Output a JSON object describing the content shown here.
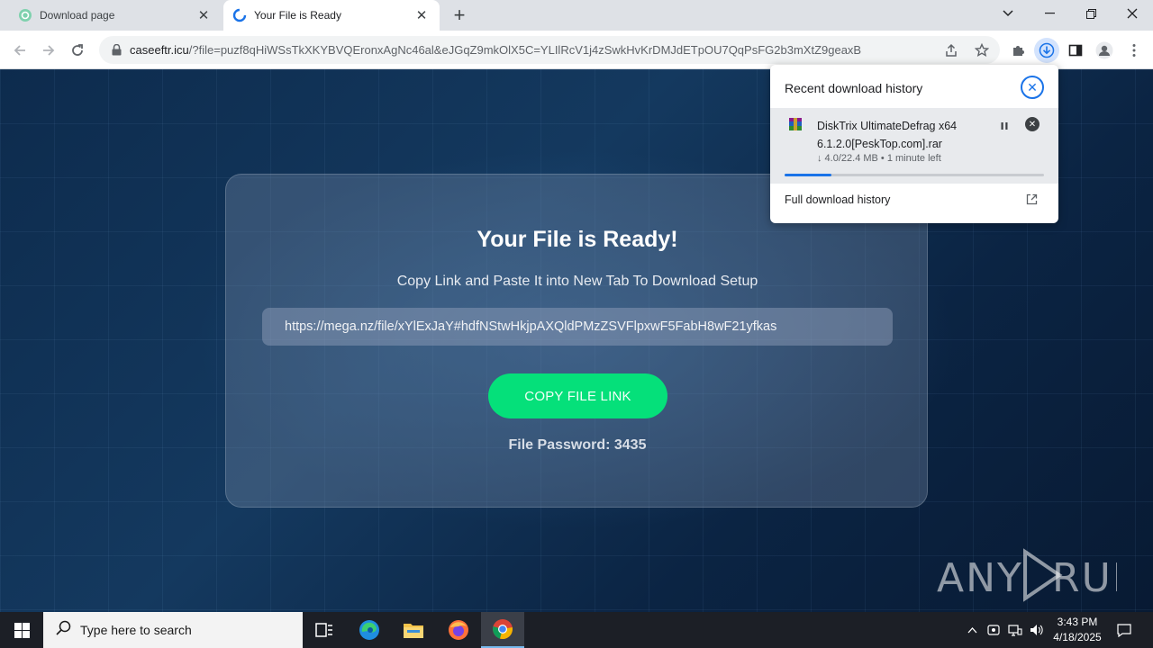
{
  "browser": {
    "tabs": [
      {
        "title": "Download page",
        "active": false
      },
      {
        "title": "Your File is Ready",
        "active": true
      }
    ],
    "url_host": "caseeftr.icu",
    "url_rest": "/?file=puzf8qHiWSsTkXKYBVQEronxAgNc46al&eJGqZ9mkOlX5C=YLIlRcV1j4zSwkHvKrDMJdETpOU7QqPsFG2b3mXtZ9geaxB"
  },
  "page": {
    "title": "Your File is Ready!",
    "subtitle": "Copy Link and Paste It into New Tab To Download Setup",
    "link": "https://mega.nz/file/xYlExJaY#hdfNStwHkjpAXQldPMzZSVFlpxwF5FabH8wF21yfkas",
    "copy_button": "COPY FILE LINK",
    "password": "File Password: 3435",
    "watermark": "ANY RUN"
  },
  "downloads": {
    "header": "Recent download history",
    "item": {
      "name": "DiskTrix UltimateDefrag x64 6.1.2.0[PeskTop.com].rar",
      "status": "↓ 4.0/22.4 MB • 1 minute left",
      "progress": 0.18
    },
    "full_history": "Full download history"
  },
  "taskbar": {
    "search_placeholder": "Type here to search",
    "time": "3:43 PM",
    "date": "4/18/2025"
  },
  "colors": {
    "accent_green": "#05e07a",
    "chrome_blue": "#1a73e8"
  }
}
